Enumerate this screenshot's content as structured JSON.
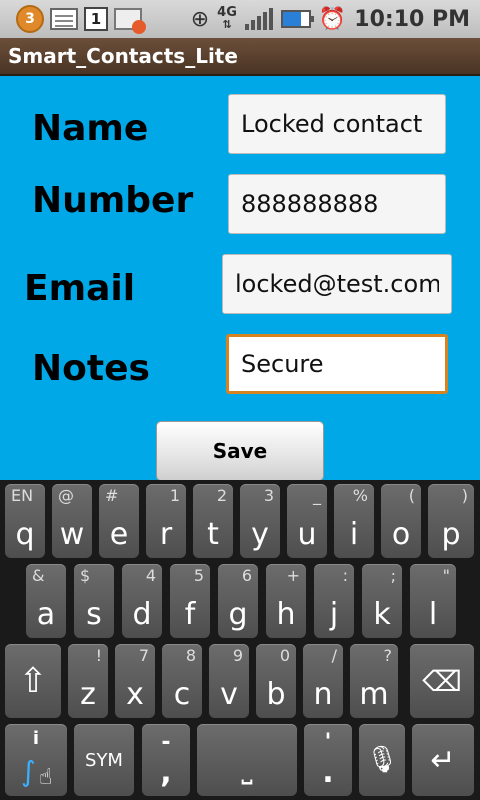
{
  "status_bar": {
    "badge_count": "3",
    "calendar_day": "1",
    "network": "4G",
    "time": "10:10 PM"
  },
  "app": {
    "title": "Smart_Contacts_Lite"
  },
  "form": {
    "name_label": "Name",
    "name_value": "Locked contact",
    "number_label": "Number",
    "number_value": "888888888",
    "email_label": "Email",
    "email_value": "locked@test.com",
    "notes_label": "Notes",
    "notes_value": "Secure",
    "save_label": "Save"
  },
  "keyboard": {
    "row1": [
      {
        "key": "q",
        "hint": "EN"
      },
      {
        "key": "w",
        "hint": "@"
      },
      {
        "key": "e",
        "hint": "#"
      },
      {
        "key": "r",
        "hint": "1"
      },
      {
        "key": "t",
        "hint": "2"
      },
      {
        "key": "y",
        "hint": "3"
      },
      {
        "key": "u",
        "hint": "_"
      },
      {
        "key": "i",
        "hint": "%"
      },
      {
        "key": "o",
        "hint": "("
      },
      {
        "key": "p",
        "hint": ")"
      }
    ],
    "row2": [
      {
        "key": "a",
        "hint": "&"
      },
      {
        "key": "s",
        "hint": "$"
      },
      {
        "key": "d",
        "hint": "4"
      },
      {
        "key": "f",
        "hint": "5"
      },
      {
        "key": "g",
        "hint": "6"
      },
      {
        "key": "h",
        "hint": "+"
      },
      {
        "key": "j",
        "hint": ":"
      },
      {
        "key": "k",
        "hint": ";"
      },
      {
        "key": "l",
        "hint": "\""
      }
    ],
    "row3": [
      {
        "key": "z",
        "hint": "!"
      },
      {
        "key": "x",
        "hint": "7"
      },
      {
        "key": "c",
        "hint": "8"
      },
      {
        "key": "v",
        "hint": "9"
      },
      {
        "key": "b",
        "hint": "0"
      },
      {
        "key": "n",
        "hint": "/"
      },
      {
        "key": "m",
        "hint": "?"
      }
    ],
    "sym_label": "SYM",
    "comma_key": ",",
    "comma_hint": "-",
    "period_key": ".",
    "period_hint": "'",
    "info_glyph": "i"
  }
}
